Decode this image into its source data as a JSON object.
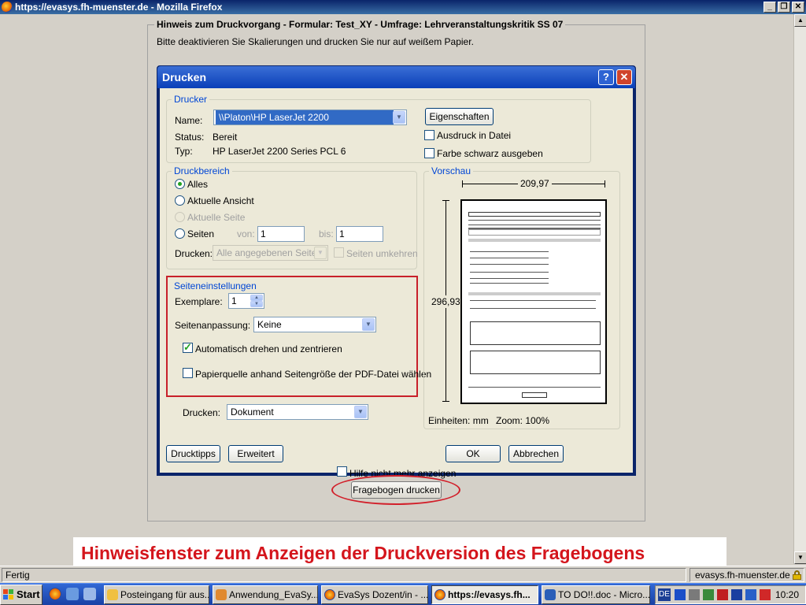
{
  "browser": {
    "title": "https://evasys.fh-muenster.de - Mozilla Firefox",
    "status_text": "Fertig",
    "status_domain": "evasys.fh-muenster.de"
  },
  "hint": {
    "legend": "Hinweis zum Druckvorgang - Formular: Test_XY - Umfrage: Lehrveranstaltungskritik SS 07",
    "text": "Bitte deaktivieren Sie Skalierungen und drucken Sie nur auf weißem Papier.",
    "dont_show_label": "Hilfe nicht mehr anzeigen",
    "print_button": "Fragebogen drucken"
  },
  "print_dialog": {
    "title": "Drucken",
    "help_glyph": "?",
    "close_glyph": "✕",
    "printer": {
      "legend": "Drucker",
      "name_label": "Name:",
      "name_value": "\\\\Platon\\HP LaserJet 2200",
      "properties_button": "Eigenschaften",
      "status_label": "Status:",
      "status_value": "Bereit",
      "type_label": "Typ:",
      "type_value": "HP LaserJet 2200 Series PCL 6",
      "print_to_file": "Ausdruck in Datei",
      "color_as_black": "Farbe schwarz ausgeben"
    },
    "range": {
      "legend": "Druckbereich",
      "all": "Alles",
      "current_view": "Aktuelle Ansicht",
      "current_page": "Aktuelle Seite",
      "pages": "Seiten",
      "from_label": "von:",
      "from_value": "1",
      "to_label": "bis:",
      "to_value": "1",
      "print_label": "Drucken:",
      "print_value": "Alle angegebenen Seiten",
      "reverse_pages": "Seiten umkehren"
    },
    "page_settings": {
      "legend": "Seiteneinstellungen",
      "copies_label": "Exemplare:",
      "copies_value": "1",
      "fit_label": "Seitenanpassung:",
      "fit_value": "Keine",
      "auto_rotate": "Automatisch drehen und zentrieren",
      "paper_source": "Papierquelle anhand Seitengröße der PDF-Datei wählen"
    },
    "print_what_label": "Drucken:",
    "print_what_value": "Dokument",
    "preview": {
      "legend": "Vorschau",
      "width": "209,97",
      "height": "296,93",
      "units": "Einheiten: mm",
      "zoom": "Zoom: 100%"
    },
    "buttons": {
      "tips": "Drucktipps",
      "advanced": "Erweitert",
      "ok": "OK",
      "cancel": "Abbrechen"
    }
  },
  "caption": "Hinweisfenster zum Anzeigen der Druckversion des Fragebogens",
  "taskbar": {
    "start": "Start",
    "tasks": [
      "Posteingang für aus...",
      "Anwendung_EvaSy...",
      "EvaSys Dozent/in - ...",
      "https://evasys.fh...",
      "TO DO!!.doc - Micro..."
    ],
    "lang": "DE",
    "clock": "10:20"
  },
  "colors": {
    "accent_red": "#d4151c",
    "xp_blue": "#0a246a",
    "group_legend_blue": "#0046d5"
  }
}
